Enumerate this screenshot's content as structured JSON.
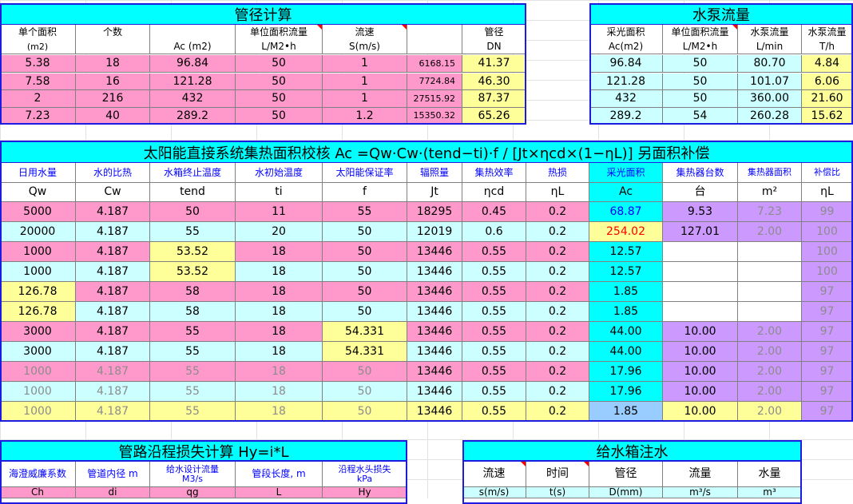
{
  "colors": {
    "cyan": "#00ffff",
    "pink": "#ff99cc",
    "light_cyan": "#ccffff",
    "yellow": "#ffff99",
    "violet": "#cc99ff",
    "blue_border": "#1c1ce0",
    "red": "#ff0000"
  },
  "pipe": {
    "title": "管径计算",
    "headers1": [
      "单个面积",
      "个数",
      "",
      "单位面积流量",
      "流速",
      "",
      "管径"
    ],
    "headers2": [
      "(m2)",
      "",
      "Ac (m2)",
      "L/M2•h",
      "S(m/s)",
      "",
      "DN"
    ],
    "rows": [
      [
        "5.38",
        "18",
        "96.84",
        "50",
        "1",
        "6168.15",
        "41.37"
      ],
      [
        "7.58",
        "16",
        "121.28",
        "50",
        "1",
        "7724.84",
        "46.30"
      ],
      [
        "2",
        "216",
        "432",
        "50",
        "1",
        "27515.92",
        "87.37"
      ],
      [
        "7.23",
        "40",
        "289.2",
        "50",
        "1.2",
        "15350.32",
        "65.26"
      ]
    ]
  },
  "pump": {
    "title": "水泵流量",
    "headers1": [
      "采光面积",
      "单位面积流量",
      "水泵流量",
      "水泵流量"
    ],
    "headers2": [
      "Ac(m2)",
      "L/M2•h",
      "L/min",
      "T/h"
    ],
    "rows": [
      [
        "96.84",
        "50",
        "80.70",
        "4.84"
      ],
      [
        "121.28",
        "50",
        "101.07",
        "6.06"
      ],
      [
        "432",
        "50",
        "360.00",
        "21.60"
      ],
      [
        "289.2",
        "54",
        "260.28",
        "15.62"
      ]
    ]
  },
  "solar": {
    "title": "太阳能直接系统集热面积校核   Ac =Qw·Cw·(tend−ti)·f / [Jt×ηcd×(1−ηL)]       另面积补偿",
    "headers1": [
      "日用水量",
      "水的比热",
      "水箱终止温度",
      "水初始温度",
      "太阳能保证率",
      "辐照量",
      "集热效率",
      "热损",
      "采光面积",
      "集热器台数",
      "集热器面积",
      "补偿比"
    ],
    "headers2": [
      "Qw",
      "Cw",
      "tend",
      "ti",
      "f",
      "Jt",
      "ηcd",
      "ηL",
      "Ac",
      "台",
      "m²",
      "ηL"
    ],
    "rows": [
      [
        "5000",
        "4.187",
        "50",
        "11",
        "55",
        "18295",
        "0.45",
        "0.2",
        "68.87",
        "9.53",
        "7.23",
        "99"
      ],
      [
        "20000",
        "4.187",
        "55",
        "20",
        "50",
        "12019",
        "0.6",
        "0.2",
        "254.02",
        "127.01",
        "2.00",
        "100"
      ],
      [
        "1000",
        "4.187",
        "53.52",
        "18",
        "50",
        "13446",
        "0.55",
        "0.2",
        "12.57",
        "",
        "",
        "100"
      ],
      [
        "1000",
        "4.187",
        "53.52",
        "18",
        "50",
        "13446",
        "0.55",
        "0.2",
        "12.57",
        "",
        "",
        "100"
      ],
      [
        "126.78",
        "4.187",
        "58",
        "18",
        "50",
        "13446",
        "0.55",
        "0.2",
        "1.85",
        "",
        "",
        "97"
      ],
      [
        "126.78",
        "4.187",
        "58",
        "18",
        "50",
        "13446",
        "0.55",
        "0.2",
        "1.85",
        "",
        "",
        "97"
      ],
      [
        "3000",
        "4.187",
        "55",
        "18",
        "54.331",
        "13446",
        "0.55",
        "0.2",
        "44.00",
        "10.00",
        "2.00",
        "97"
      ],
      [
        "3000",
        "4.187",
        "55",
        "18",
        "54.331",
        "13446",
        "0.55",
        "0.2",
        "44.00",
        "10.00",
        "2.00",
        "97"
      ],
      [
        "1000",
        "4.187",
        "55",
        "18",
        "50",
        "13446",
        "0.55",
        "0.2",
        "17.96",
        "10.00",
        "2.00",
        "97"
      ],
      [
        "1000",
        "4.187",
        "55",
        "18",
        "50",
        "13446",
        "0.55",
        "0.2",
        "17.96",
        "10.00",
        "2.00",
        "97"
      ],
      [
        "1000",
        "4.187",
        "55",
        "18",
        "50",
        "13446",
        "0.55",
        "0.2",
        "1.85",
        "10.00",
        "2.00",
        "97"
      ]
    ]
  },
  "loss": {
    "title": "管路沿程损失计算 Hy=i*L",
    "headers1": [
      "海澄威廉系数",
      "管道内径 m",
      "给水设计流量\nM3/s",
      "管段长度, m",
      "沿程水头损失\nkPa"
    ],
    "headers2": [
      "Ch",
      "di",
      "qg",
      "L",
      "Hy"
    ]
  },
  "tank": {
    "title": "给水箱注水",
    "headers1": [
      "流速",
      "时间",
      "管径",
      "流量",
      "水量"
    ],
    "headers2": [
      "s(m/s)",
      "t(s)",
      "D(mm)",
      "m³/s",
      "m³"
    ]
  }
}
